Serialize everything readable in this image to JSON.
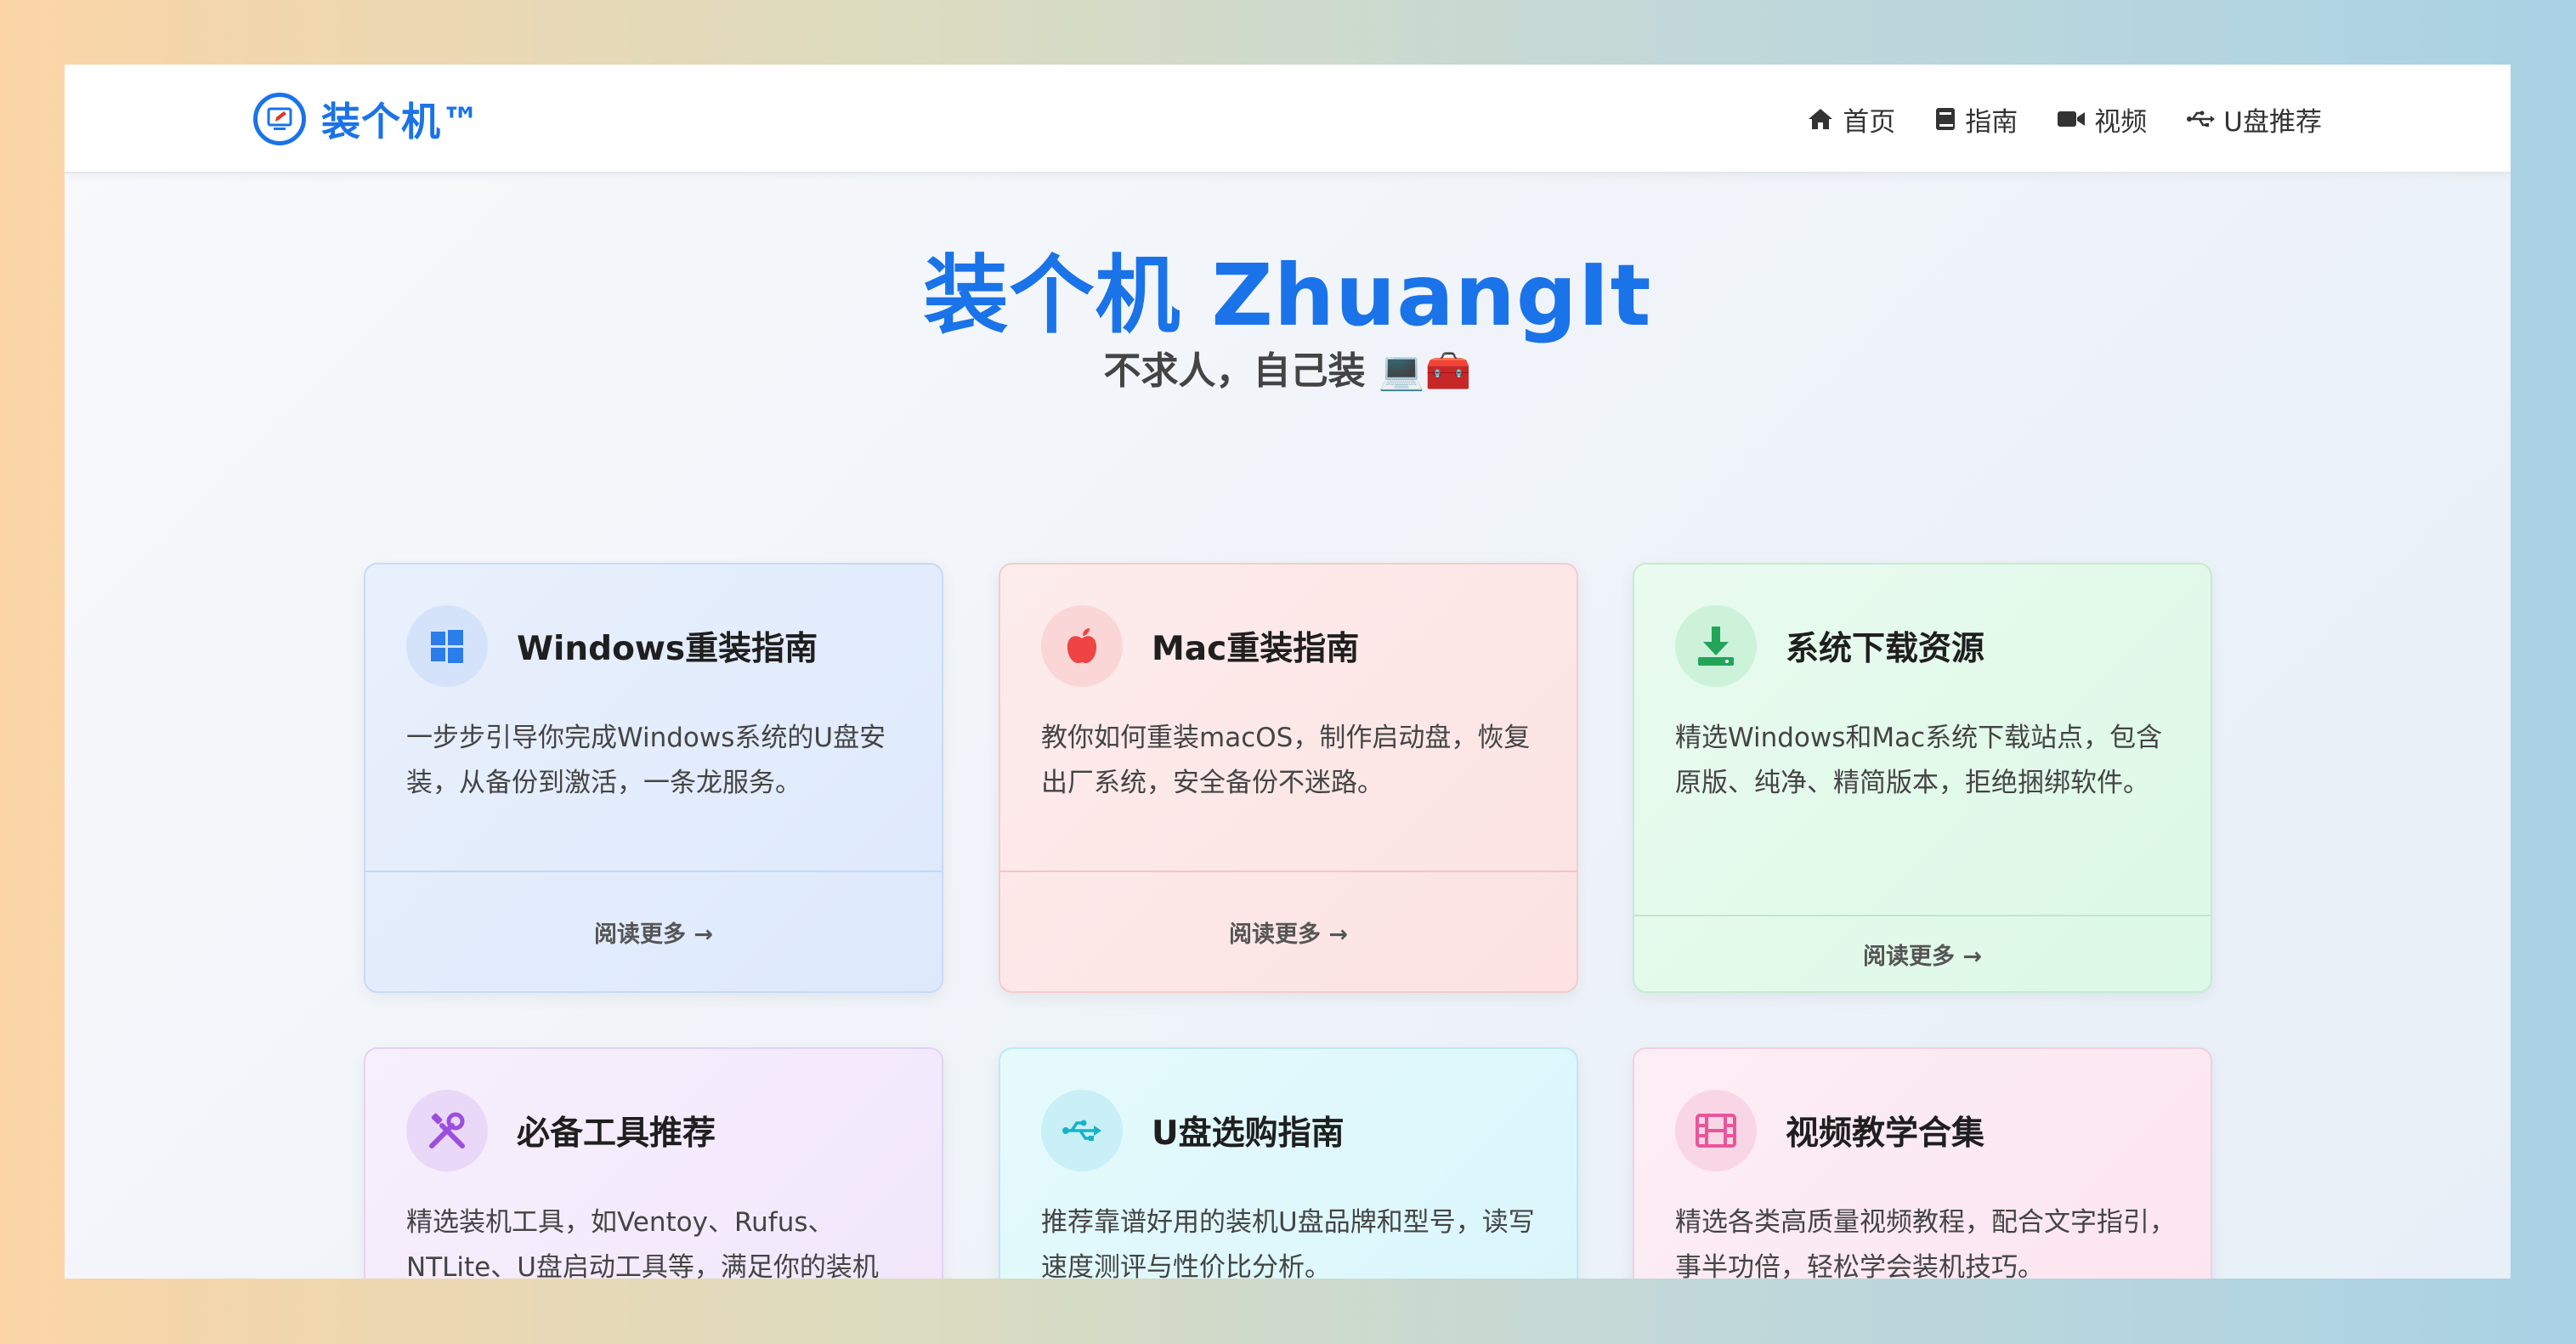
{
  "brand": {
    "name": "装个机™"
  },
  "nav": [
    {
      "label": "首页",
      "icon": "home-icon"
    },
    {
      "label": "指南",
      "icon": "book-icon"
    },
    {
      "label": "视频",
      "icon": "video-icon"
    },
    {
      "label": "U盘推荐",
      "icon": "usb-icon"
    }
  ],
  "hero": {
    "title": "装个机 ZhuangIt",
    "subtitle": "不求人，自己装 💻🧰"
  },
  "cards": [
    {
      "title": "Windows重装指南",
      "desc": "一步步引导你完成Windows系统的U盘安装，从备份到激活，一条龙服务。",
      "link": "阅读更多 →",
      "icon": "windows-icon",
      "color": "#2b7de9"
    },
    {
      "title": "Mac重装指南",
      "desc": "教你如何重装macOS，制作启动盘，恢复出厂系统，安全备份不迷路。",
      "link": "阅读更多 →",
      "icon": "apple-icon",
      "color": "#ef4444"
    },
    {
      "title": "系统下载资源",
      "desc": "精选Windows和Mac系统下载站点，包含原版、纯净、精简版本，拒绝捆绑软件。",
      "link": "阅读更多 →",
      "icon": "download-icon",
      "color": "#22a559"
    },
    {
      "title": "必备工具推荐",
      "desc": "精选装机工具，如Ventoy、Rufus、NTLite、U盘启动工具等，满足你的装机",
      "icon": "tools-icon",
      "color": "#9b4fe0"
    },
    {
      "title": "U盘选购指南",
      "desc": "推荐靠谱好用的装机U盘品牌和型号，读写速度测评与性价比分析。",
      "icon": "usb-icon",
      "color": "#16b3c9"
    },
    {
      "title": "视频教学合集",
      "desc": "精选各类高质量视频教程，配合文字指引，事半功倍，轻松学会装机技巧。",
      "icon": "film-icon",
      "color": "#e9559a"
    }
  ]
}
